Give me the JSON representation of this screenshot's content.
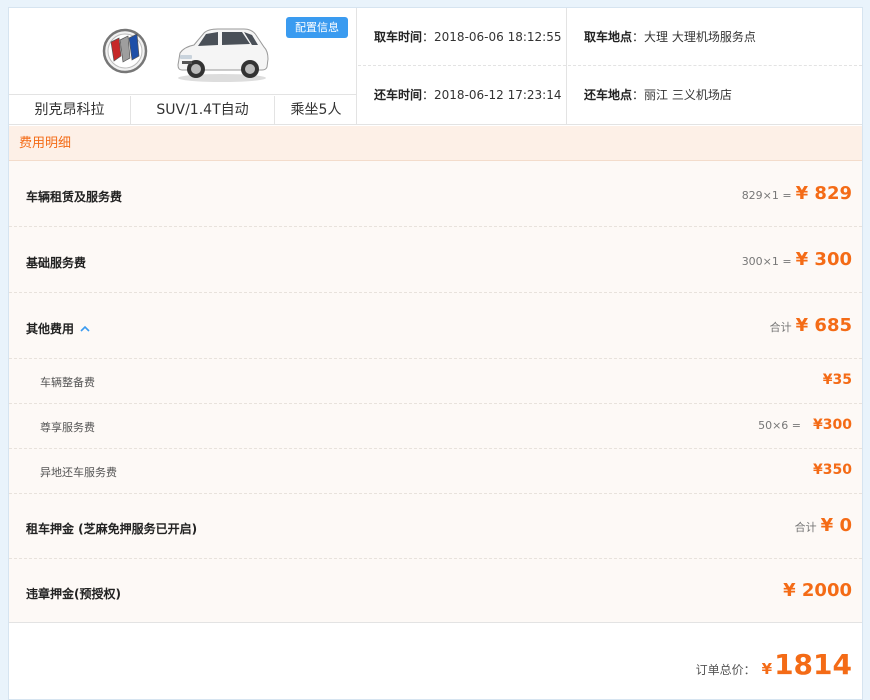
{
  "car": {
    "brand_logo_icon": "buick-logo-icon",
    "car_image_icon": "white-suv-car-icon",
    "config_button_label": "配置信息",
    "specs": [
      {
        "text": "别克昂科拉"
      },
      {
        "text": "SUV/1.4T自动"
      },
      {
        "text": "乘坐5人"
      }
    ]
  },
  "pickup": {
    "time_label": "取车时间",
    "time_value": "2018-06-06 18:12:55",
    "place_label": "取车地点",
    "place_value": "大理 大理机场服务点"
  },
  "return": {
    "time_label": "还车时间",
    "time_value": "2018-06-12 17:23:14",
    "place_label": "还车地点",
    "place_value": "丽江 三义机场店"
  },
  "colon": "：",
  "fees": {
    "header": "费用明细",
    "rental": {
      "label": "车辆租赁及服务费",
      "calc": "829×1 =",
      "amount": "¥ 829"
    },
    "basic": {
      "label": "基础服务费",
      "calc": "300×1 =",
      "amount": "¥ 300"
    },
    "other": {
      "label": "其他费用",
      "calc": "合计",
      "amount": "¥ 685"
    },
    "other_items": [
      {
        "label": "车辆整备费",
        "calc": "",
        "amount": "¥35"
      },
      {
        "label": "尊享服务费",
        "calc": "50×6 =",
        "amount": "¥300"
      },
      {
        "label": "异地还车服务费",
        "calc": "",
        "amount": "¥350"
      }
    ],
    "deposit": {
      "label": "租车押金 (芝麻免押服务已开启)",
      "calc": "合计",
      "amount": "¥ 0"
    },
    "violation": {
      "label": "违章押金(预授权)",
      "amount": "¥ 2000"
    }
  },
  "total": {
    "label": "订单总价：",
    "currency": "¥",
    "amount": "1814"
  },
  "colors": {
    "accent": "#f46b16",
    "button": "#3a9bf0"
  }
}
